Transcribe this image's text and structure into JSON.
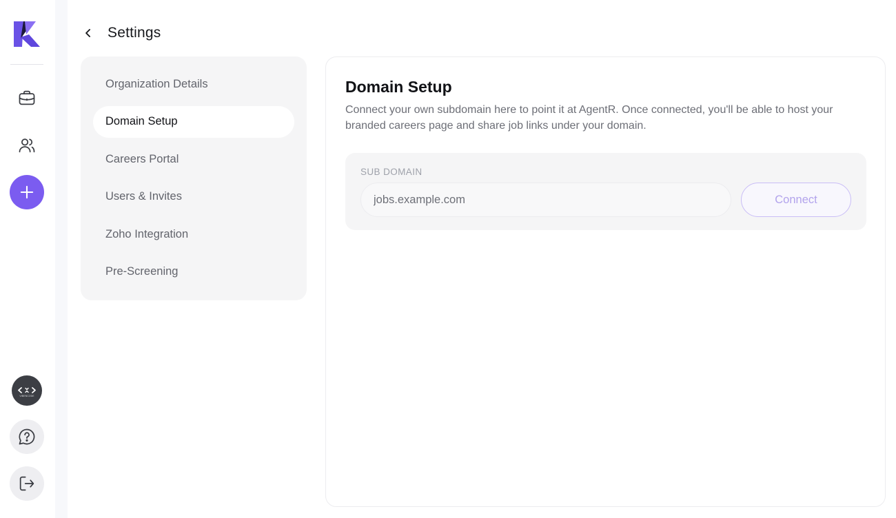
{
  "header": {
    "title": "Settings",
    "back_icon": "chevron-left-icon"
  },
  "rail": {
    "logo_icon": "agentr-logo-icon",
    "items": [
      {
        "icon": "briefcase-icon"
      },
      {
        "icon": "users-icon"
      },
      {
        "icon": "plus-icon"
      },
      {
        "icon": "vibencode-avatar-icon",
        "avatar_text": "VIBENCODE"
      },
      {
        "icon": "help-chat-icon"
      },
      {
        "icon": "logout-icon"
      }
    ]
  },
  "menu": {
    "items": [
      {
        "label": "Organization Details"
      },
      {
        "label": "Domain Setup",
        "active": true
      },
      {
        "label": "Careers Portal"
      },
      {
        "label": "Users & Invites"
      },
      {
        "label": "Zoho Integration"
      },
      {
        "label": "Pre-Screening"
      }
    ]
  },
  "panel": {
    "title": "Domain Setup",
    "description": "Connect your own subdomain here to point it at AgentR. Once connected, you'll be able to host your branded careers page and share job links under your domain.",
    "field_label": "SUB DOMAIN",
    "field_value": "",
    "field_placeholder": "jobs.example.com",
    "connect_label": "Connect"
  },
  "colors": {
    "accent": "#7b5cf0",
    "logo_dark": "#1c1a3a",
    "menu_bg": "#f5f5f6",
    "connect_border": "#c9bdf6"
  }
}
